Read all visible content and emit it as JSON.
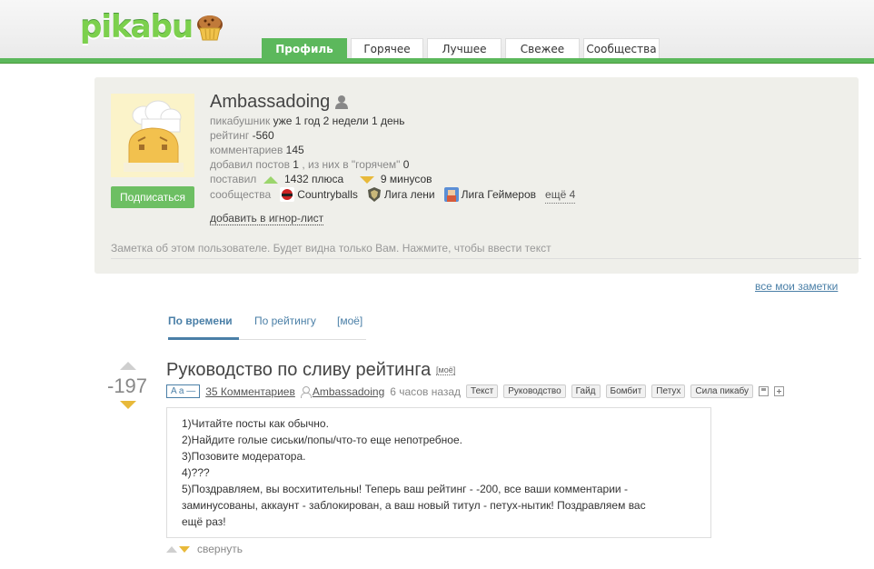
{
  "header": {
    "logo_text": "pikabu",
    "tabs": [
      {
        "label": "Профиль",
        "active": true
      },
      {
        "label": "Горячее",
        "active": false
      },
      {
        "label": "Лучшее",
        "active": false
      },
      {
        "label": "Свежее",
        "active": false
      },
      {
        "label": "Сообщества",
        "active": false
      }
    ]
  },
  "profile": {
    "username": "Ambassadoing",
    "subscribe_label": "Подписаться",
    "pikabu_label": "пикабушник",
    "pikabu_value": "уже 1 год 2 недели 1 день",
    "rating_label": "рейтинг",
    "rating_value": "-560",
    "comments_label": "комментариев",
    "comments_value": "145",
    "posts_label": "добавил постов",
    "posts_value": "1",
    "posts_hot_label": ", из них в \"горячем\"",
    "posts_hot_value": "0",
    "votes_label": "поставил",
    "plus_value": "1432 плюса",
    "minus_value": "9 минусов",
    "communities_label": "сообщества",
    "communities": [
      {
        "name": "Countryballs",
        "icon": "countryballs-icon"
      },
      {
        "name": "Лига лени",
        "icon": "liga-leni-icon"
      },
      {
        "name": "Лига Геймеров",
        "icon": "liga-geimerov-icon"
      }
    ],
    "more_communities": "ещё 4",
    "ignore_label": "добавить в игнор-лист",
    "note_placeholder": "Заметка об этом пользователе. Будет видна только Вам. Нажмите, чтобы ввести текст"
  },
  "all_notes_label": "все мои заметки",
  "sort_tabs": [
    {
      "label": "По времени",
      "active": true
    },
    {
      "label": "По рейтингу",
      "active": false
    },
    {
      "label": "[моё]",
      "active": false
    }
  ],
  "post": {
    "rating": "-197",
    "title": "Руководство по сливу рейтинга",
    "moe_badge": "[моё]",
    "aa_label": "A a —",
    "comments_link": "35 Комментариев",
    "author": "Ambassadoing",
    "time": "6 часов назад",
    "tags": [
      "Текст",
      "Руководство",
      "Гайд",
      "Бомбит",
      "Петух",
      "Сила пикабу"
    ],
    "body_lines": [
      "1)Читайте посты как обычно.",
      "2)Найдите голые сиськи/попы/что-то еще непотребное.",
      "3)Позовите модератора.",
      "4)???",
      "5)Поздравляем, вы восхитительны! Теперь ваш рейтинг - -200, все ваши комментарии -",
      "заминусованы, аккаунт - заблокирован, а ваш новый титул - петух-нытик! Поздравляем вас",
      "ещё раз!"
    ],
    "collapse_label": "свернуть"
  },
  "colors": {
    "brand_green": "#5cb85c",
    "link_blue": "#4a7fa7",
    "minus_yellow": "#e8b93a",
    "plus_green": "#9bd56c"
  }
}
